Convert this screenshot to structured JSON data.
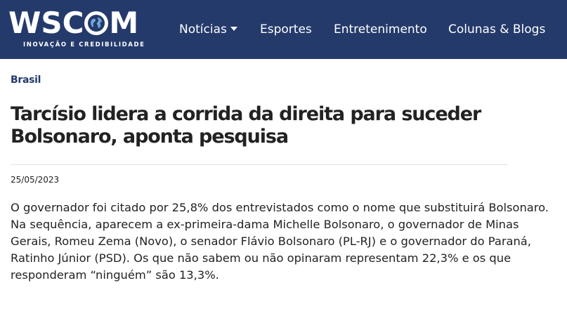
{
  "header": {
    "logo_text_before": "WSC",
    "logo_text_after": "M",
    "logo_tagline": "INOVAÇÃO E CREDIBILIDADE",
    "logo_globe_icon": "globe-icon",
    "background_color": "#243a6b",
    "nav": [
      {
        "label": "Notícias",
        "has_dropdown": true
      },
      {
        "label": "Esportes"
      },
      {
        "label": "Entretenimento"
      },
      {
        "label": "Colunas & Blogs"
      }
    ]
  },
  "article": {
    "category": "Brasil",
    "title": "Tarcísio lidera a corrida da direita para suceder Bolsonaro, aponta pesquisa",
    "date": "25/05/2023",
    "body": "O governador foi citado por 25,8% dos entrevistados como o nome que substituirá Bolsonaro. Na sequência, aparecem a ex-primeira-dama Michelle Bolsonaro, o governador de Minas Gerais, Romeu Zema (Novo), o senador Flávio Bolsonaro (PL-RJ) e o governador do Paraná, Ratinho Júnior (PSD). Os que não sabem ou não opinaram representam 22,3% e os que responderam “ninguém” são 13,3%."
  }
}
